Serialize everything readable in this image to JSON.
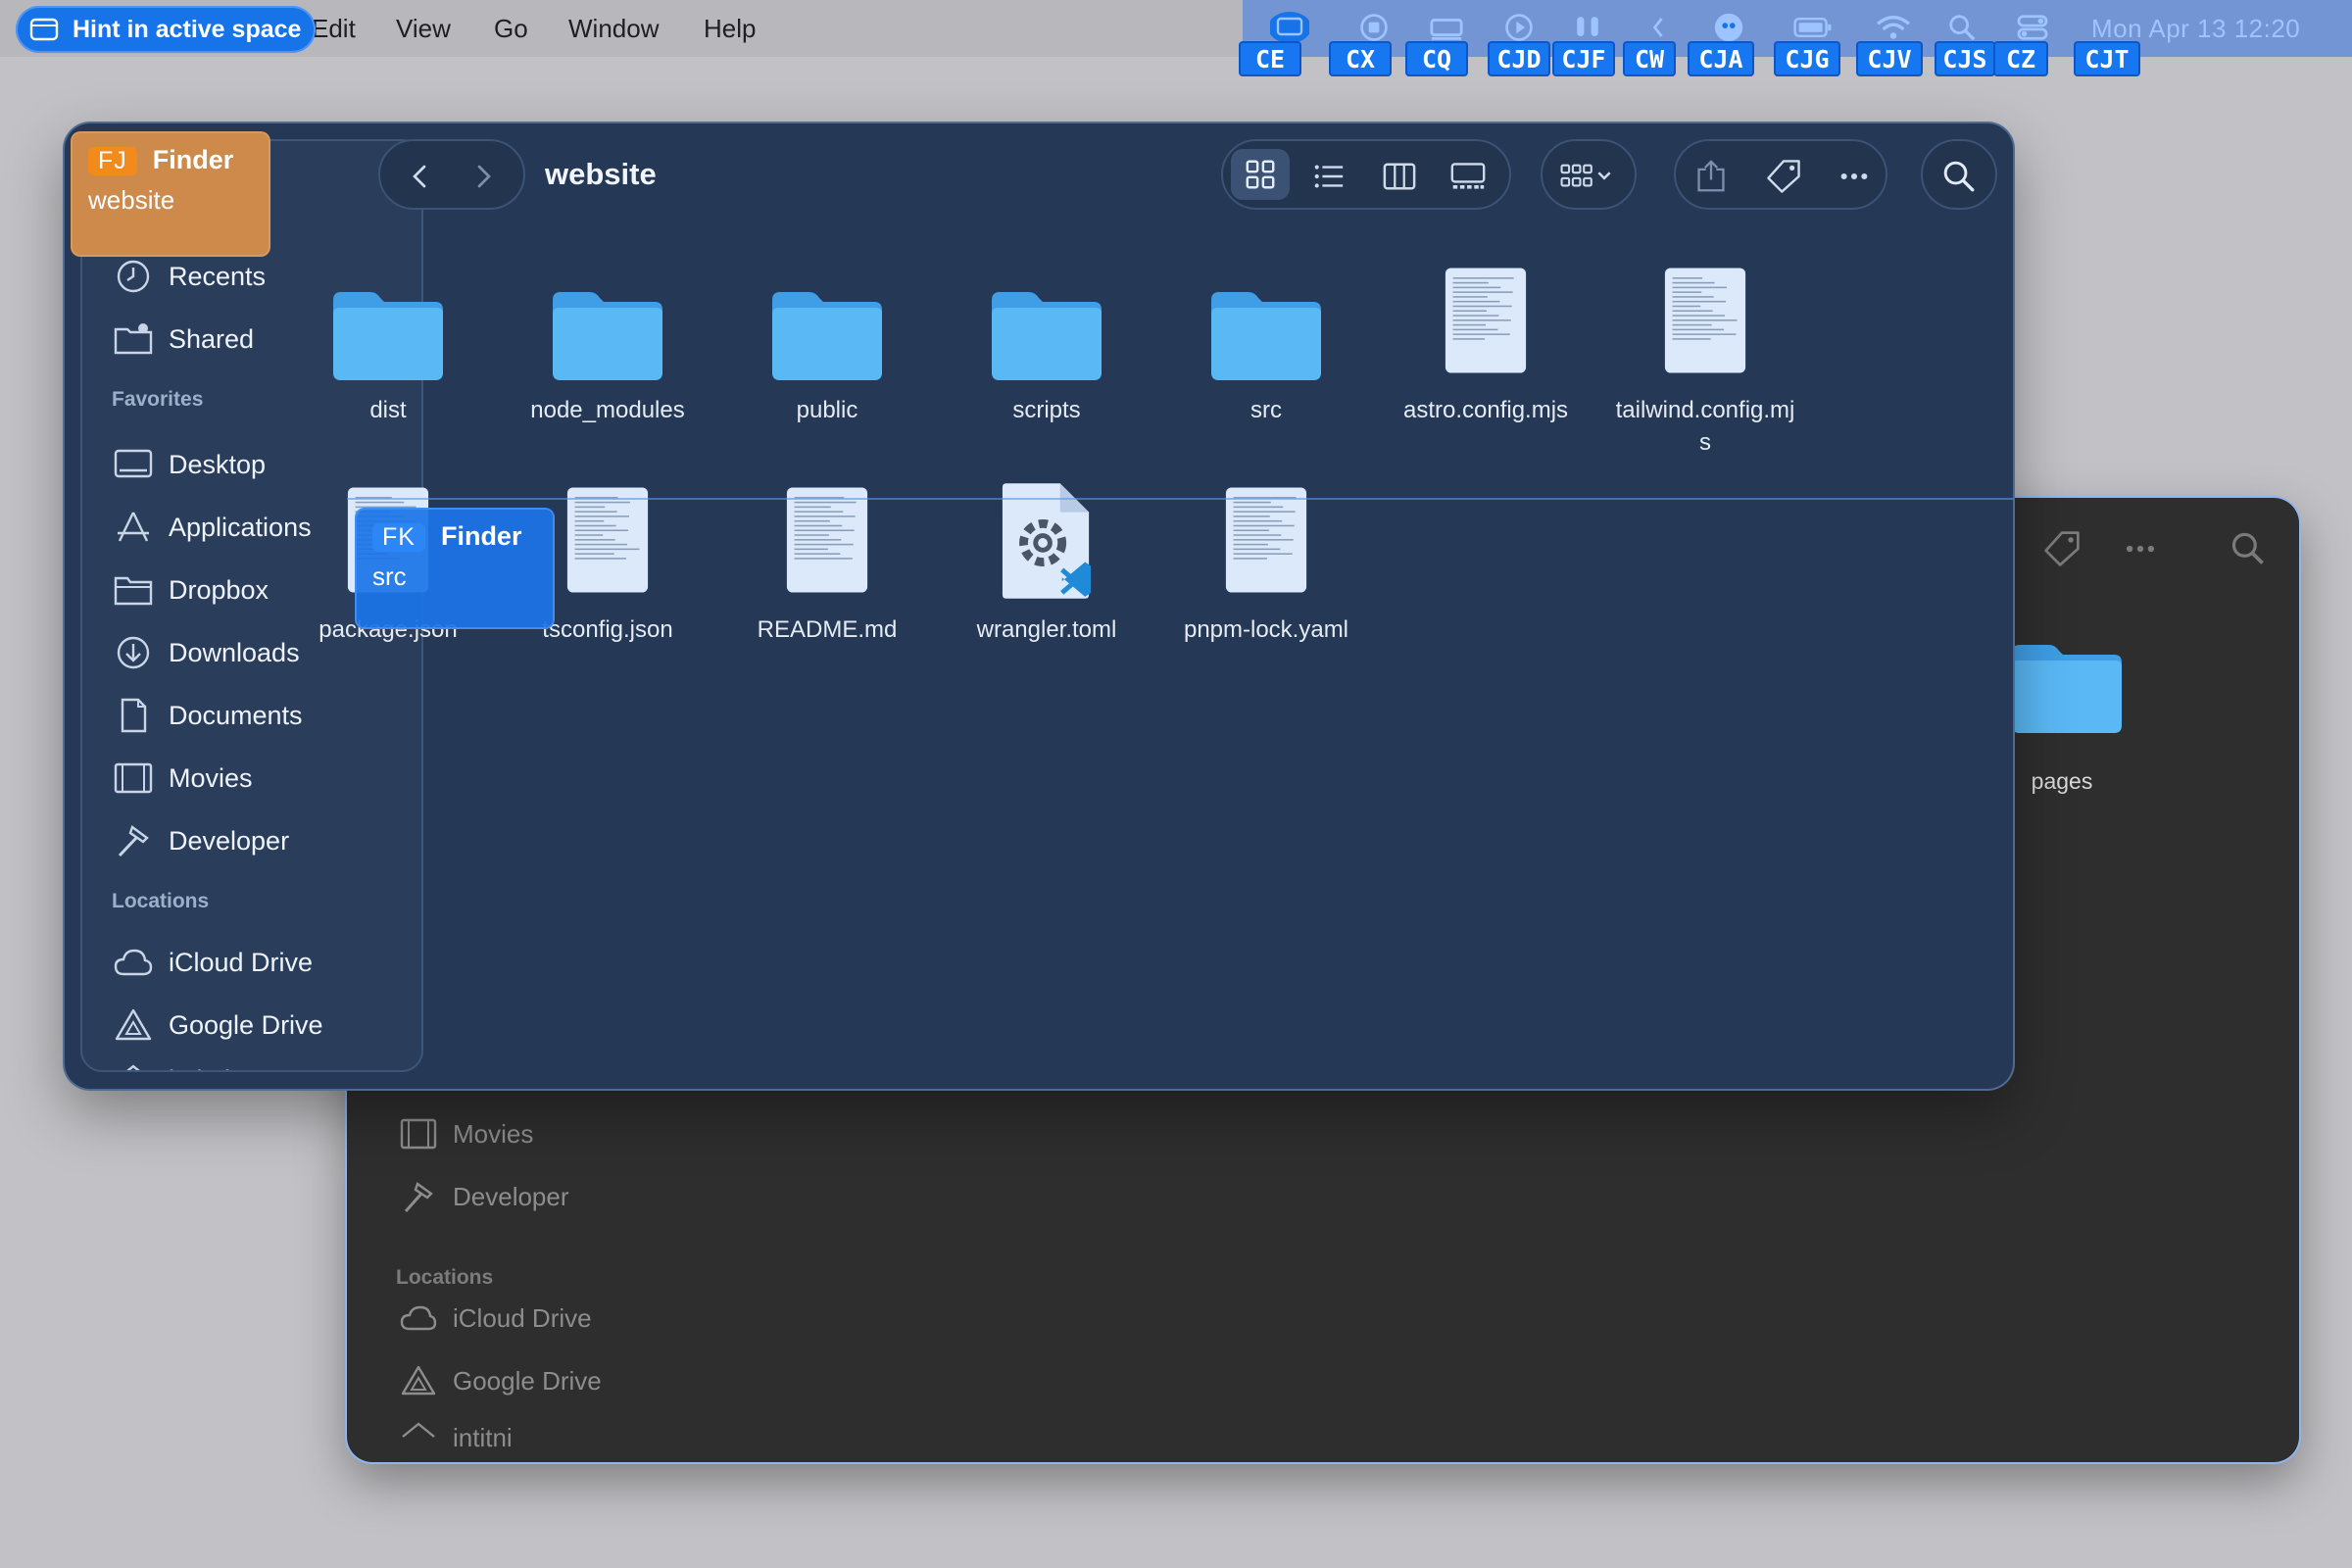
{
  "menubar": {
    "hint_pill": "Hint in active space",
    "items": [
      "Edit",
      "View",
      "Go",
      "Window",
      "Help"
    ],
    "clock": "Mon Apr 13  12:20",
    "badges": [
      "CE",
      "CX",
      "CQ",
      "CJD",
      "CJF",
      "CW",
      "CJA",
      "CJG",
      "CJV",
      "CJS",
      "CZ",
      "CJT"
    ]
  },
  "front_window": {
    "title": "website",
    "sidebar": {
      "top_items": [
        "Recents",
        "Shared"
      ],
      "favorites_header": "Favorites",
      "favorites": [
        "Desktop",
        "Applications",
        "Dropbox",
        "Downloads",
        "Documents",
        "Movies",
        "Developer"
      ],
      "locations_header": "Locations",
      "locations": [
        "iCloud Drive",
        "Google Drive",
        "intitni"
      ]
    },
    "files": [
      {
        "name": "dist",
        "kind": "folder"
      },
      {
        "name": "node_modules",
        "kind": "folder"
      },
      {
        "name": "public",
        "kind": "folder"
      },
      {
        "name": "scripts",
        "kind": "folder"
      },
      {
        "name": "src",
        "kind": "folder"
      },
      {
        "name": "astro.config.mjs",
        "kind": "doc"
      },
      {
        "name": "tailwind.config.mjs",
        "kind": "doc",
        "label_lines": [
          "tailwind.config.mj",
          "s"
        ]
      },
      {
        "name": "package.json",
        "kind": "doc"
      },
      {
        "name": "tsconfig.json",
        "kind": "doc"
      },
      {
        "name": "README.md",
        "kind": "doc"
      },
      {
        "name": "wrangler.toml",
        "kind": "toml"
      },
      {
        "name": "pnpm-lock.yaml",
        "kind": "doc"
      }
    ]
  },
  "back_window": {
    "folder": "pages",
    "sidebar": {
      "items": [
        "Movies",
        "Developer"
      ],
      "locations_header": "Locations",
      "locations": [
        "iCloud Drive",
        "Google Drive",
        "intitni"
      ]
    }
  },
  "hints": {
    "fj": {
      "code": "FJ",
      "app": "Finder",
      "sub": "website"
    },
    "fk": {
      "code": "FK",
      "app": "Finder",
      "sub": "src"
    }
  },
  "colors": {
    "hint_blue": "#1773e8",
    "hint_orange": "#d8843a",
    "folder_blue": "#5ab8f5"
  }
}
